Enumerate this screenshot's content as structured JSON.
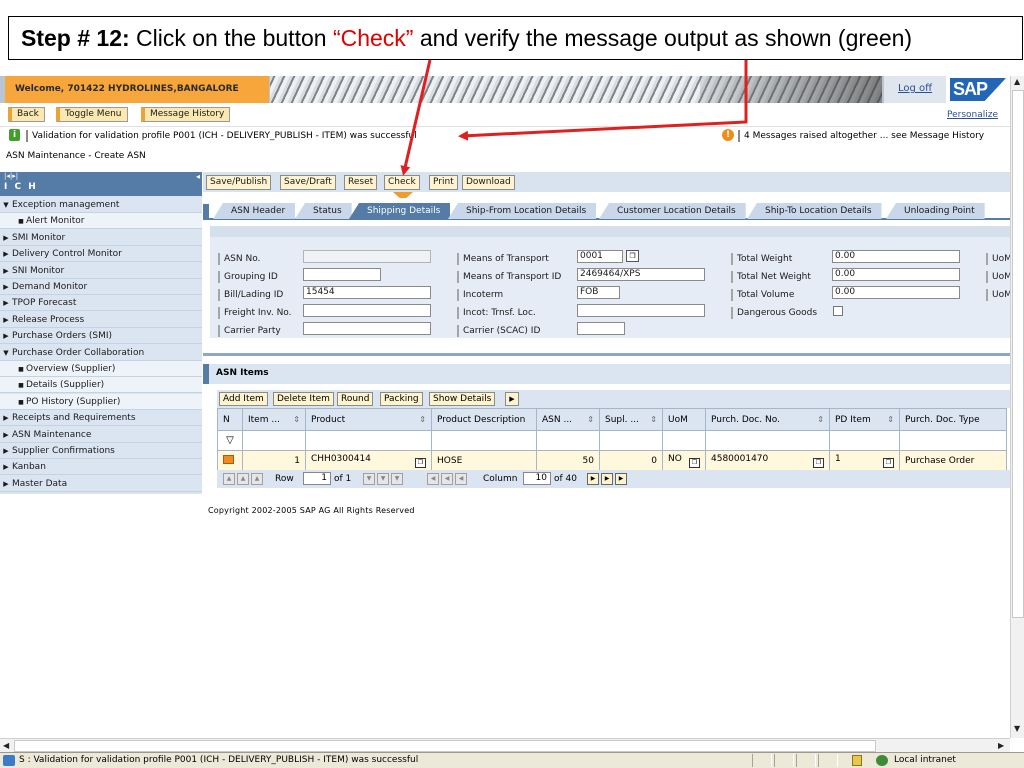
{
  "instruction": {
    "step": "Step # 12:",
    "pre": " Click on the button ",
    "highlight": "“Check”",
    "post": " and verify the message output as shown (green)"
  },
  "header": {
    "welcome": "Welcome, 701422   HYDROLINES,BANGALORE",
    "logoff": "Log off",
    "logo": "SAP"
  },
  "nav": {
    "back": "Back",
    "toggle_menu": "Toggle Menu",
    "message_history": "Message History",
    "personalize": "Personalize"
  },
  "messages": {
    "success": "Validation for validation profile P001 (ICH - DELIVERY_PUBLISH - ITEM) was successful",
    "summary": "4 Messages raised altogether ... see Message History"
  },
  "breadcrumb": "ASN Maintenance - Create ASN",
  "sidebar": {
    "title": "I C H",
    "items": [
      {
        "label": "Exception management",
        "type": "open"
      },
      {
        "label": "Alert Monitor",
        "type": "sub"
      },
      {
        "label": "SMI Monitor",
        "type": "closed"
      },
      {
        "label": "Delivery Control Monitor",
        "type": "closed"
      },
      {
        "label": "SNI Monitor",
        "type": "closed"
      },
      {
        "label": "Demand Monitor",
        "type": "closed"
      },
      {
        "label": "TPOP Forecast",
        "type": "closed"
      },
      {
        "label": "Release Process",
        "type": "closed"
      },
      {
        "label": "Purchase Orders (SMI)",
        "type": "closed"
      },
      {
        "label": "Purchase Order Collaboration",
        "type": "open"
      },
      {
        "label": "Overview (Supplier)",
        "type": "sub"
      },
      {
        "label": "Details (Supplier)",
        "type": "sub"
      },
      {
        "label": "PO History (Supplier)",
        "type": "sub"
      },
      {
        "label": "Receipts and Requirements",
        "type": "closed"
      },
      {
        "label": "ASN Maintenance",
        "type": "closed"
      },
      {
        "label": "Supplier Confirmations",
        "type": "closed"
      },
      {
        "label": "Kanban",
        "type": "closed"
      },
      {
        "label": "Master Data",
        "type": "closed"
      }
    ]
  },
  "toolbar": {
    "save_publish": "Save/Publish",
    "save_draft": "Save/Draft",
    "reset": "Reset",
    "check": "Check",
    "print": "Print",
    "download": "Download"
  },
  "tabs": [
    "ASN Header",
    "Status",
    "Shipping Details",
    "Ship-From Location Details",
    "Customer Location Details",
    "Ship-To Location Details",
    "Unloading Point"
  ],
  "active_tab": "Shipping Details",
  "shipping": {
    "asn_no_label": "ASN No.",
    "asn_no": "",
    "grouping_id_label": "Grouping ID",
    "grouping_id": "",
    "bill_lading_label": "Bill/Lading ID",
    "bill_lading": "15454",
    "freight_inv_label": "Freight Inv. No.",
    "freight_inv": "",
    "carrier_party_label": "Carrier Party",
    "carrier_party": "",
    "means_transport_label": "Means of Transport",
    "means_transport": "0001",
    "means_transport_id_label": "Means of Transport ID",
    "means_transport_id": "2469464/XPS",
    "incoterm_label": "Incoterm",
    "incoterm": "FOB",
    "incot_loc_label": "Incot: Trnsf. Loc.",
    "incot_loc": "",
    "carrier_scac_label": "Carrier (SCAC) ID",
    "carrier_scac": "",
    "total_weight_label": "Total Weight",
    "total_weight": "0.00",
    "total_net_weight_label": "Total Net Weight",
    "total_net_weight": "0.00",
    "total_volume_label": "Total Volume",
    "total_volume": "0.00",
    "dangerous_goods_label": "Dangerous Goods",
    "uom_label": "UoM"
  },
  "items": {
    "title": "ASN Items",
    "buttons": [
      "Add Item",
      "Delete Item",
      "Round",
      "Packing",
      "Show Details"
    ],
    "columns": [
      "N",
      "Item ...",
      "Product",
      "Product Description",
      "ASN ...",
      "Supl. ...",
      "UoM",
      "Purch. Doc. No.",
      "PD Item",
      "Purch. Doc. Type"
    ],
    "rows": [
      {
        "item": "1",
        "product": "CHH0300414",
        "description": "HOSE",
        "asn_qty": "50",
        "supl_qty": "0",
        "uom": "NO",
        "purch_doc_no": "4580001470",
        "pd_item": "1",
        "purch_doc_type": "Purchase Order"
      }
    ]
  },
  "pager": {
    "row_label": "Row",
    "row_value": "1",
    "row_of": "of 1",
    "column_label": "Column",
    "column_value": "10",
    "column_of": "of 40"
  },
  "copyright": "Copyright 2002-2005 SAP AG All Rights Reserved",
  "statusbar": {
    "message": "S : Validation for validation profile P001 (ICH - DELIVERY_PUBLISH - ITEM) was successful",
    "zone": "Local intranet"
  },
  "colors": {
    "instruction_highlight": "#e00000",
    "annotation_arrow": "#e02020",
    "header_orange": "#f7a63c",
    "nav_blue": "#557ba7",
    "success_green": "#40a02a",
    "warning_orange": "#ef8d1b"
  }
}
